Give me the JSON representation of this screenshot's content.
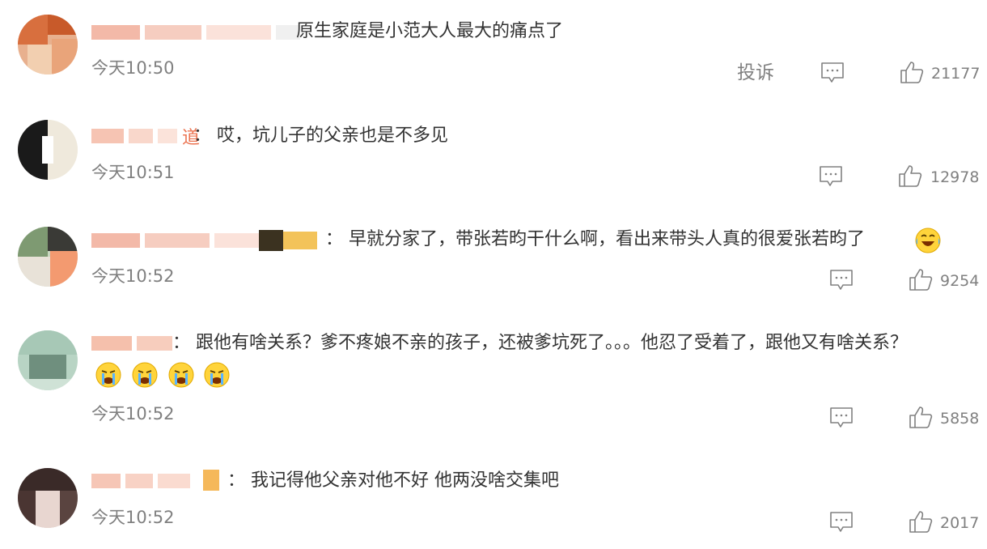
{
  "report_label": "投诉",
  "comments": [
    {
      "name_tail": "",
      "text": "原生家庭是小范大人最大的痛点了",
      "time": "今天10:50",
      "likes": "21177"
    },
    {
      "name_tail": "道",
      "text": "：  哎，坑儿子的父亲也是不多见",
      "time": "今天10:51",
      "likes": "12978"
    },
    {
      "name_tail": "",
      "text": "：  早就分家了，带张若昀干什么啊，看出来带头人真的很爱张若昀了",
      "time": "今天10:52",
      "likes": "9254"
    },
    {
      "name_tail": "",
      "text": "：  跟他有啥关系？爹不疼娘不亲的孩子，还被爹坑死了。。。他忍了受着了，跟他又有啥关系？",
      "time": "今天10:52",
      "likes": "5858"
    },
    {
      "name_tail": "",
      "text": "：  我记得他父亲对他不好  他两没啥交集吧",
      "time": "今天10:52",
      "likes": "2017"
    }
  ],
  "colors": {
    "text": "#333333",
    "meta": "#808080",
    "name_tail": "#eb7350"
  },
  "icons": {
    "reply": "comment-bubble-icon",
    "like": "thumbs-up-icon",
    "emoji_laugh": "laughing-tears-emoji",
    "emoji_cry": "crying-emoji"
  }
}
